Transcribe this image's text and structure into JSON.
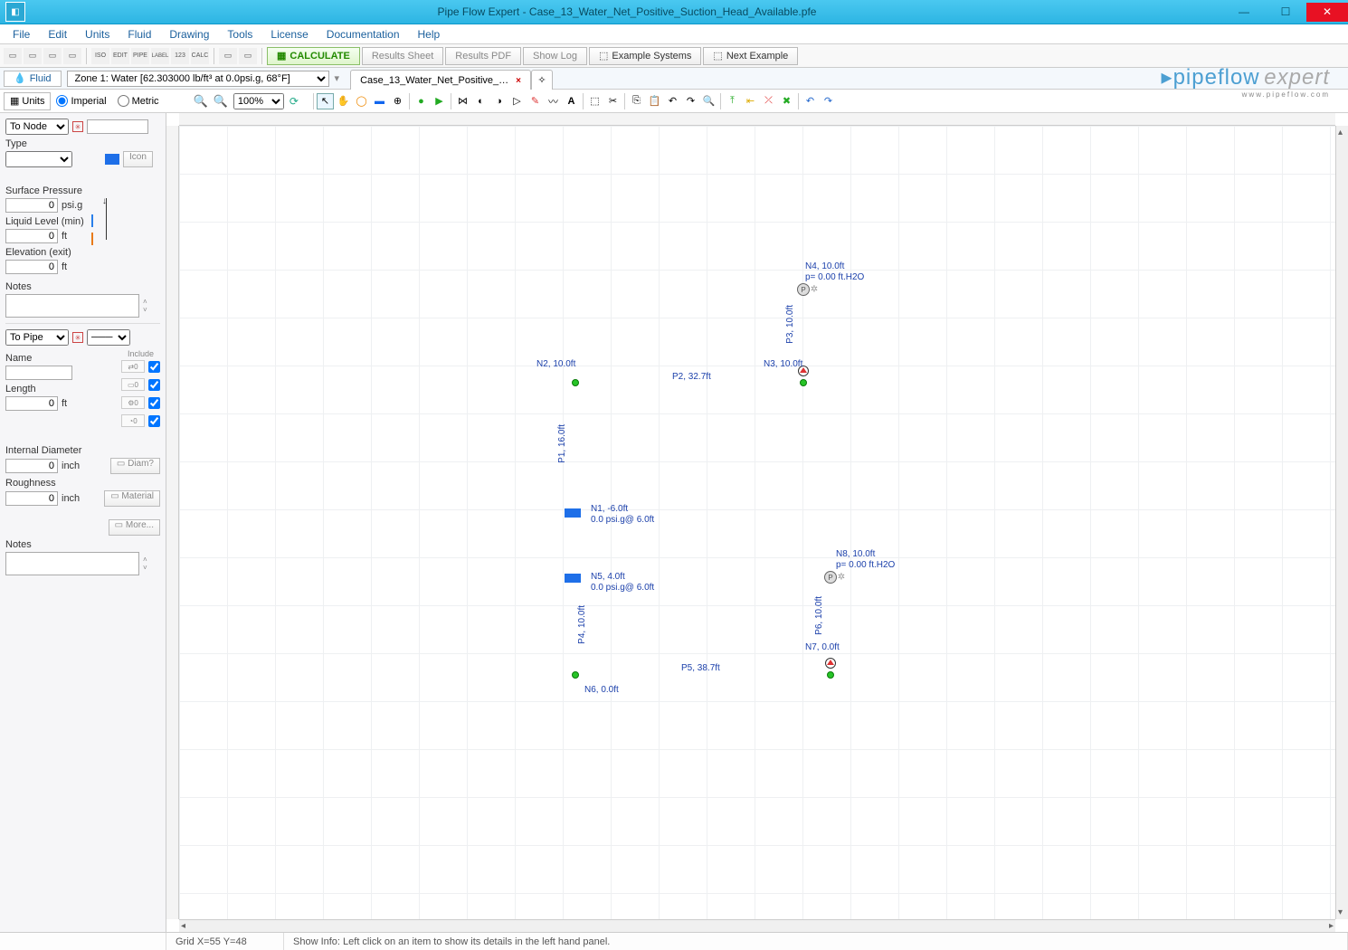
{
  "title": "Pipe Flow Expert - Case_13_Water_Net_Positive_Suction_Head_Available.pfe",
  "menu": [
    "File",
    "Edit",
    "Units",
    "Fluid",
    "Drawing",
    "Tools",
    "License",
    "Documentation",
    "Help"
  ],
  "toolbar": {
    "smallicons": [
      "▭",
      "▭",
      "▭",
      "▭",
      "ISO",
      "EDIT",
      "PIPE",
      "LABEL",
      "123",
      "CALC",
      "▭",
      "▭"
    ],
    "calculate": "CALCULATE",
    "resultsSheet": "Results Sheet",
    "resultsPdf": "Results PDF",
    "showLog": "Show Log",
    "exampleSystems": "Example Systems",
    "nextExample": "Next Example"
  },
  "fluidbar": {
    "fluidBtn": "Fluid",
    "zone": "Zone 1: Water [62.303000 lb/ft³ at 0.0psi.g, 68°F]",
    "tab": "Case_13_Water_Net_Positive_…"
  },
  "logo": {
    "brand1": "pipeflow",
    "brand2": "expert",
    "url": "www.pipeflow.com"
  },
  "unitsbar": {
    "unitsBtn": "Units",
    "imperial": "Imperial",
    "metric": "Metric",
    "zoom": "100%"
  },
  "sidebar": {
    "toNode": "To Node",
    "type": "Type",
    "iconBtn": "Icon",
    "surfPressure": {
      "label": "Surface Pressure",
      "value": "0",
      "unit": "psi.g"
    },
    "liquidLevel": {
      "label": "Liquid Level (min)",
      "value": "0",
      "unit": "ft"
    },
    "elevationExit": {
      "label": "Elevation (exit)",
      "value": "0",
      "unit": "ft"
    },
    "notes1": "Notes",
    "toPipe": "To Pipe",
    "name": {
      "label": "Name",
      "value": ""
    },
    "include": "Include",
    "length": {
      "label": "Length",
      "value": "0",
      "unit": "ft"
    },
    "internalDiameter": {
      "label": "Internal Diameter",
      "value": "0",
      "unit": "inch"
    },
    "diamBtn": "Diam?",
    "roughness": {
      "label": "Roughness",
      "value": "0",
      "unit": "inch"
    },
    "materialBtn": "Material",
    "moreBtn": "More...",
    "notes2": "Notes"
  },
  "diagram": {
    "nodes": {
      "N1": {
        "label": "N1, -6.0ft",
        "sub": "0.0 psi.g@ 6.0ft"
      },
      "N2": {
        "label": "N2, 10.0ft"
      },
      "N3": {
        "label": "N3, 10.0ft"
      },
      "N4": {
        "label": "N4, 10.0ft",
        "sub": "p= 0.00 ft.H2O"
      },
      "N5": {
        "label": "N5, 4.0ft",
        "sub": "0.0 psi.g@ 6.0ft"
      },
      "N6": {
        "label": "N6, 0.0ft"
      },
      "N7": {
        "label": "N7, 0.0ft"
      },
      "N8": {
        "label": "N8, 10.0ft",
        "sub": "p= 0.00 ft.H2O"
      }
    },
    "pipes": {
      "P1": "P1, 16.0ft",
      "P2": "P2, 32.7ft",
      "P3": "P3, 10.0ft",
      "P4": "P4, 10.0ft",
      "P5": "P5, 38.7ft",
      "P6": "P6, 10.0ft"
    }
  },
  "status": {
    "grid": "Grid  X=55  Y=48",
    "info": "Show Info: Left click on an item to show its details in the left hand panel."
  }
}
